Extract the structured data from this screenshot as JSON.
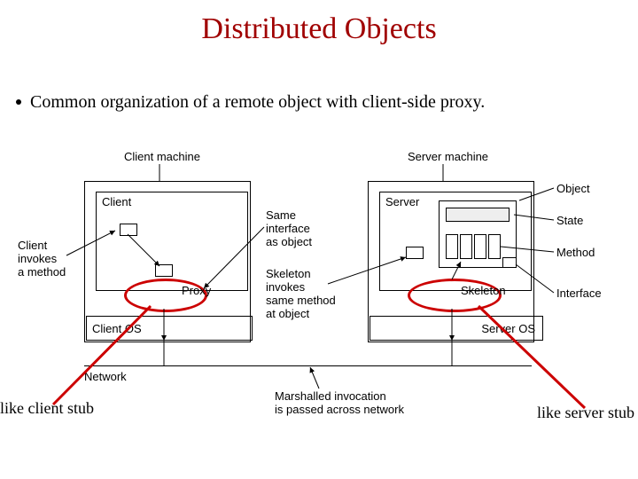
{
  "title": "Distributed Objects",
  "bullet_text": "Common organization of a remote object with client-side proxy.",
  "labels": {
    "client_machine": "Client machine",
    "server_machine": "Server machine",
    "client": "Client",
    "server": "Server",
    "object": "Object",
    "state": "State",
    "method": "Method",
    "interface": "Interface",
    "client_invokes": "Client\ninvokes\na method",
    "same_interface": "Same\ninterface\nas object",
    "skeleton_invokes": "Skeleton\ninvokes\nsame method\nat object",
    "proxy": "Proxy",
    "skeleton": "Skeleton",
    "client_os": "Client OS",
    "server_os": "Server OS",
    "network": "Network",
    "marshalled": "Marshalled invocation\nis passed across network"
  },
  "annotations": {
    "like_client_stub": "like client stub",
    "like_server_stub": "like server stub"
  }
}
